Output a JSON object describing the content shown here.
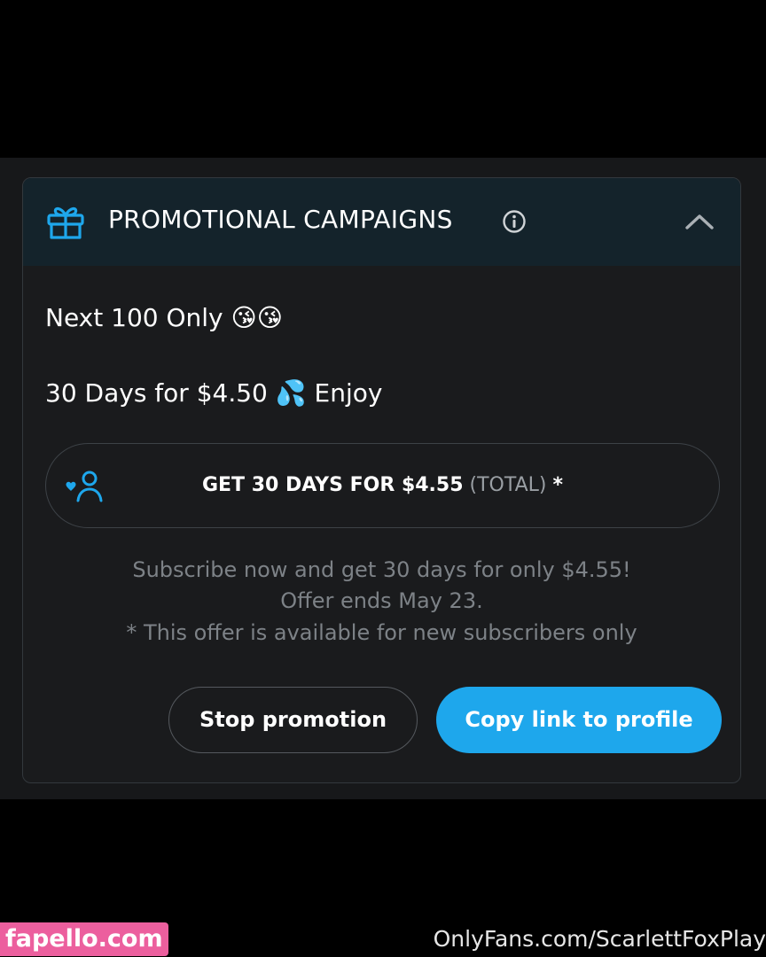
{
  "header": {
    "title": "PROMOTIONAL CAMPAIGNS",
    "icon": "gift-icon",
    "info_icon": "info-icon",
    "toggle_icon": "chevron-up-icon"
  },
  "promo": {
    "line1": "Next 100 Only 😘😘",
    "line2": "30 Days for $4.50 💦 Enjoy"
  },
  "offer": {
    "icon": "subscriber-heart-icon",
    "main": "GET 30 DAYS FOR $4.55",
    "total": "(TOTAL)",
    "star": "*"
  },
  "notes": {
    "line1": "Subscribe now and get 30 days for only $4.55!",
    "line2": "Offer ends May 23.",
    "line3": "* This offer is available for new subscribers only"
  },
  "actions": {
    "stop_label": "Stop promotion",
    "copy_label": "Copy link to profile"
  },
  "watermarks": {
    "left": "fapello.com",
    "right": "OnlyFans.com/ScarlettFoxPlay"
  },
  "colors": {
    "accent": "#1ea7ec",
    "header_bg": "#14232b",
    "card_bg": "#1a1b1d",
    "muted_text": "#7d8287",
    "watermark_pink": "#ec5f9e"
  }
}
